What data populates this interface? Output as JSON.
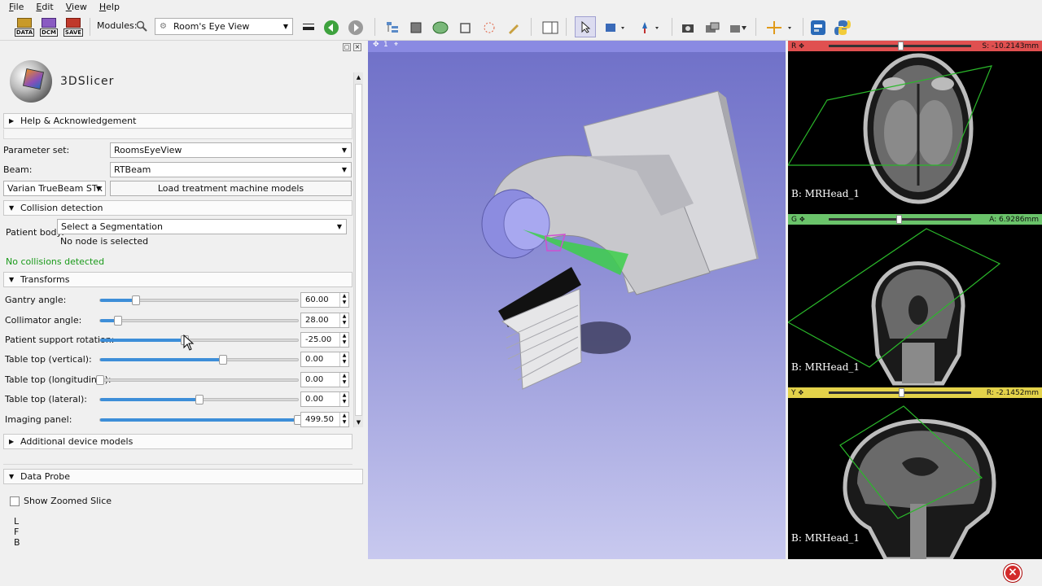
{
  "menu": {
    "items": [
      "File",
      "Edit",
      "View",
      "Help"
    ]
  },
  "toolbar": {
    "data_label": "DATA",
    "dcm_label": "DCM",
    "save_label": "SAVE",
    "modules_label": "Modules:",
    "module_value": "Room's Eye View"
  },
  "module_panel": {
    "logo_text": "3DSlicer",
    "help_section": "Help & Acknowledgement",
    "parameter_set_label": "Parameter set:",
    "parameter_set_value": "RoomsEyeView",
    "beam_label": "Beam:",
    "beam_value": "RTBeam",
    "machine_value": "Varian TrueBeam STx",
    "load_button": "Load treatment machine models",
    "collision_section": "Collision detection",
    "patient_body_label": "Patient body:",
    "patient_body_value": "Select a Segmentation",
    "no_node_text": "No node is selected",
    "collision_status": "No collisions detected",
    "transforms_section": "Transforms",
    "sliders": [
      {
        "label": "Gantry angle:",
        "value": "60.00",
        "fraction": 0.18
      },
      {
        "label": "Collimator angle:",
        "value": "28.00",
        "fraction": 0.09
      },
      {
        "label": "Patient support rotation:",
        "value": "-25.00",
        "fraction": 0.43
      },
      {
        "label": "Table top (vertical):",
        "value": "0.00",
        "fraction": 0.62
      },
      {
        "label": "Table top (longitudinal):",
        "value": "0.00",
        "fraction": 0.0
      },
      {
        "label": "Table top (lateral):",
        "value": "0.00",
        "fraction": 0.5
      },
      {
        "label": "Imaging panel:",
        "value": "499.50",
        "fraction": 1.0
      }
    ],
    "additional_section": "Additional device models"
  },
  "data_probe": {
    "section": "Data Probe",
    "show_zoomed_label": "Show Zoomed Slice",
    "coords": [
      "L",
      "F",
      "B"
    ]
  },
  "view3d": {
    "index": "1"
  },
  "slices": [
    {
      "letter": "R",
      "color": "#e05050",
      "value": "S: -10.2143mm",
      "label": "B: MRHead_1",
      "position": 0.5
    },
    {
      "letter": "G",
      "color": "#6ac36a",
      "value": "A: 6.9286mm",
      "label": "B: MRHead_1",
      "position": 0.49
    },
    {
      "letter": "Y",
      "color": "#e3d24a",
      "value": "R: -2.1452mm",
      "label": "B: MRHead_1",
      "position": 0.51
    }
  ],
  "colors": {
    "accent": "#3d8ed8",
    "status_ok": "#1a9a1a",
    "view_bg": "#8f90d6"
  }
}
